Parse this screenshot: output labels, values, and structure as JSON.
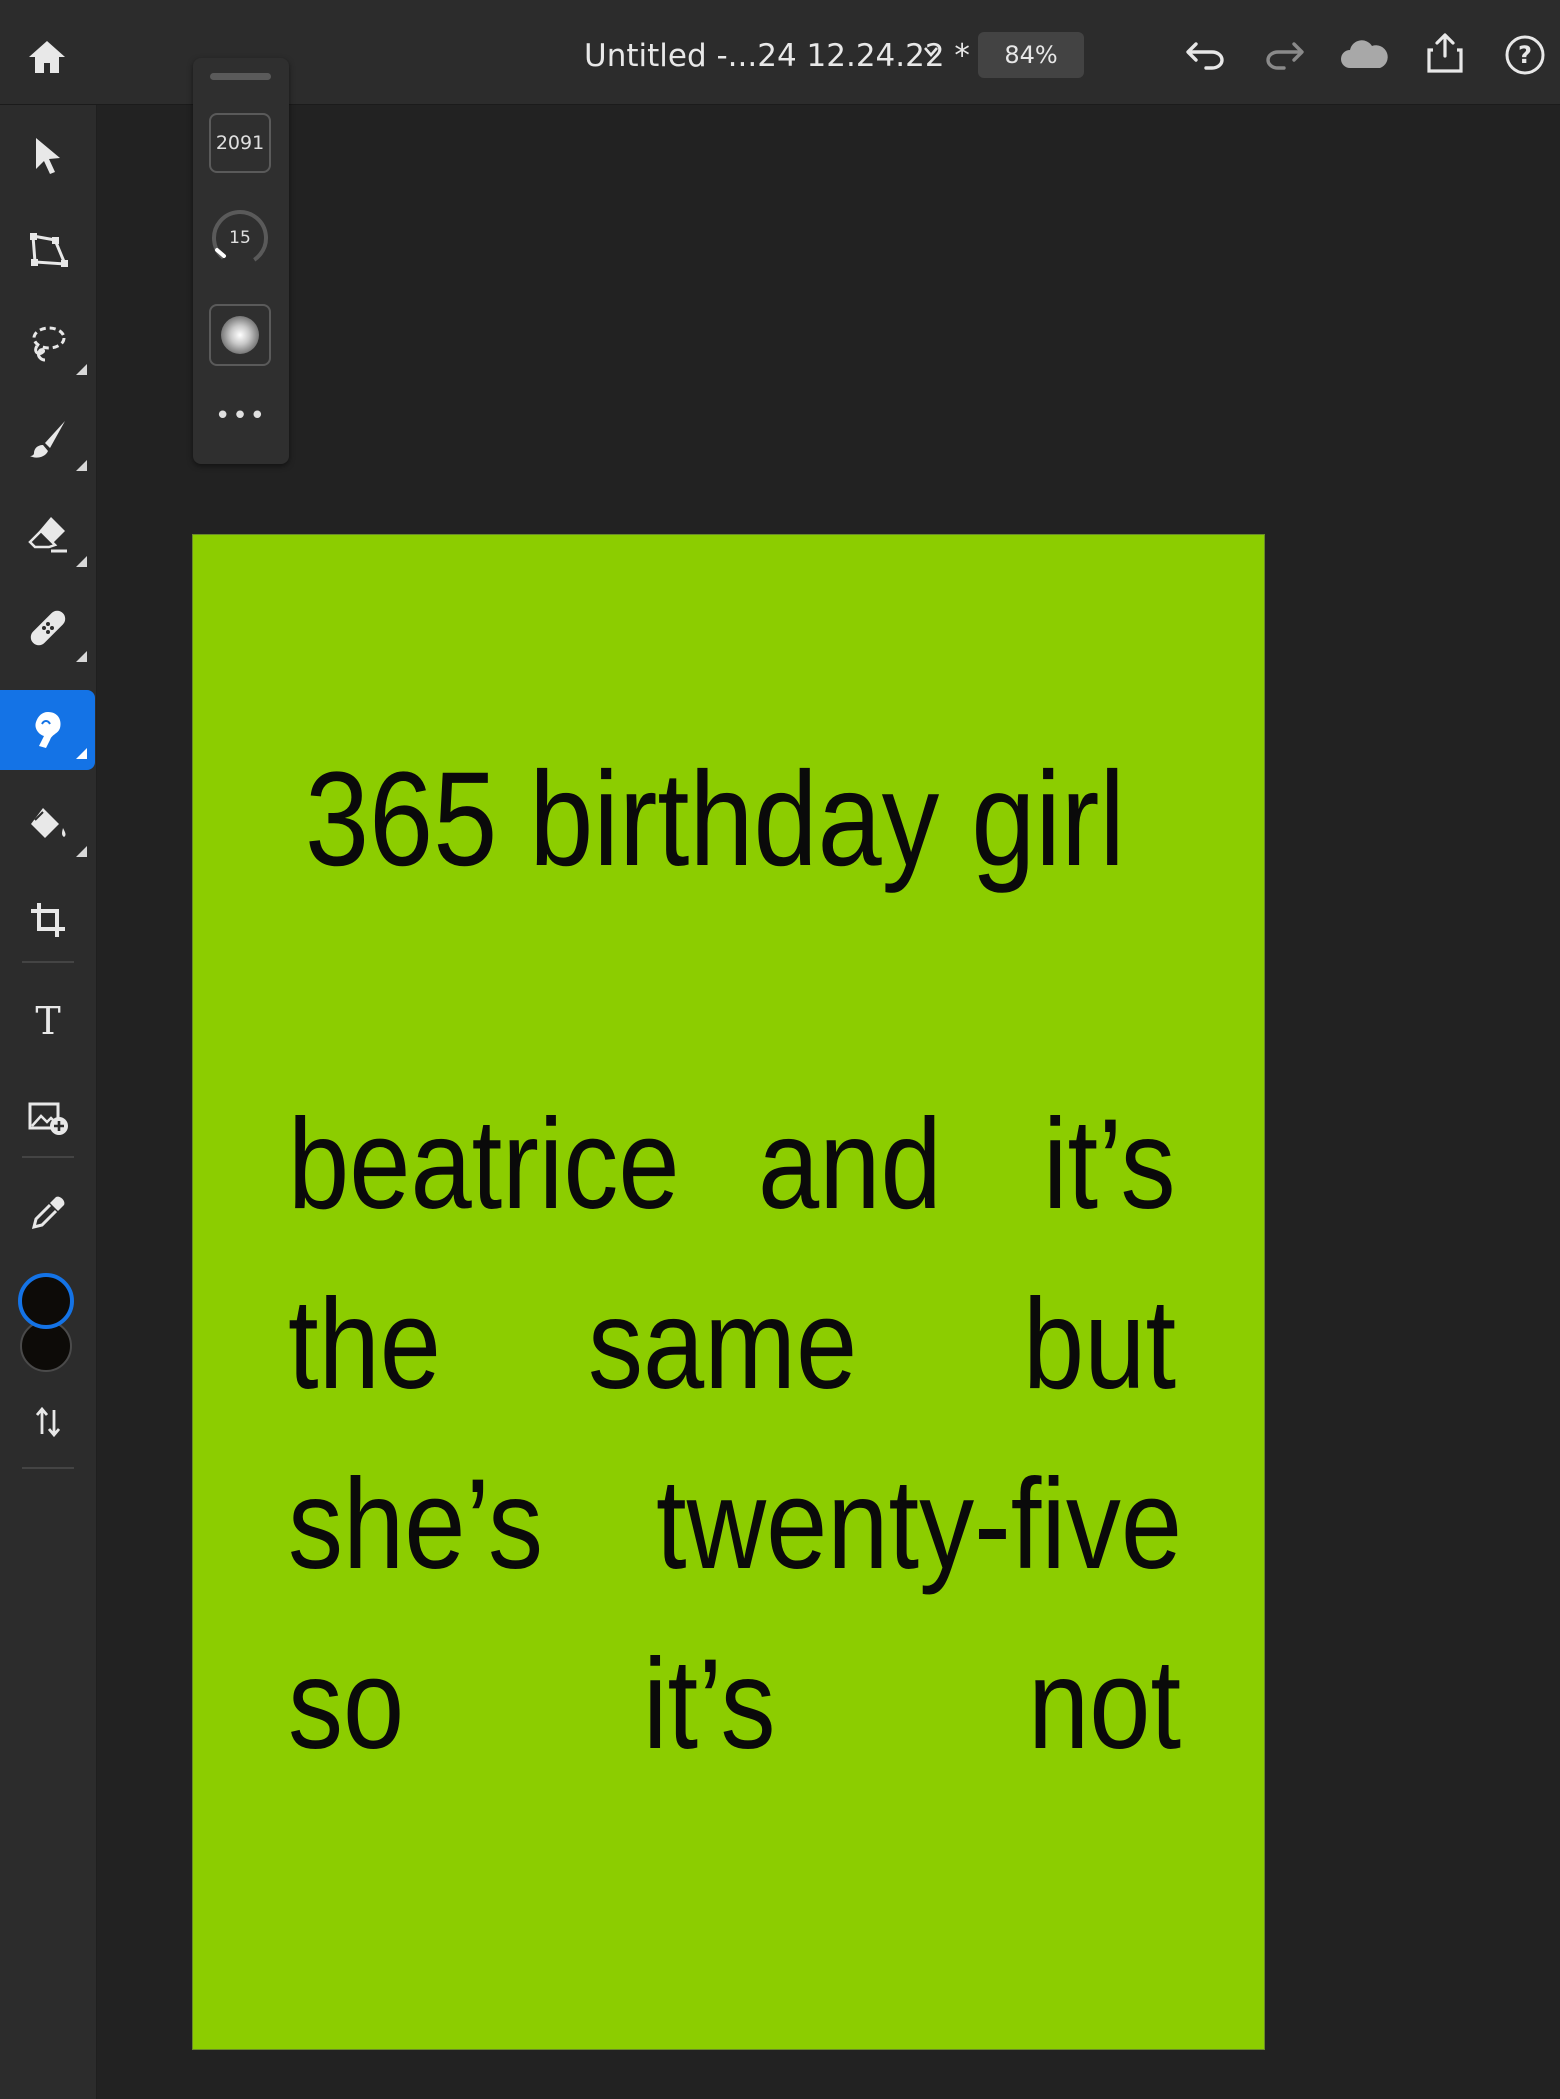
{
  "topbar": {
    "doc_title": "Untitled -...24 12.24.22 *",
    "zoom": "84%",
    "icons": [
      "home-icon",
      "chevron-down-icon",
      "undo-icon",
      "redo-icon",
      "cloud-icon",
      "share-icon",
      "help-icon"
    ]
  },
  "toolbar": {
    "tools": [
      "select-tool",
      "transform-tool",
      "lasso-tool",
      "brush-tool",
      "eraser-tool",
      "healing-tool",
      "smudge-tool",
      "fill-tool",
      "crop-tool",
      "type-tool",
      "place-image-tool",
      "eyedropper-tool",
      "swap-colors-tool"
    ],
    "active_tool": "smudge-tool",
    "foreground_color": "#0d0b08",
    "background_color": "#0d0b08",
    "active_color": "#1473e6"
  },
  "brush_panel": {
    "size": "2091",
    "hardness": "15",
    "more": "•••"
  },
  "artboard": {
    "background": "#8ccd00",
    "title": "365 birthday girl",
    "lines": [
      [
        "beatrice",
        "and",
        "it’s"
      ],
      [
        "the",
        "same",
        "but"
      ],
      [
        "she’s",
        "twenty-five"
      ],
      [
        "so",
        "it’s",
        "not"
      ]
    ]
  }
}
